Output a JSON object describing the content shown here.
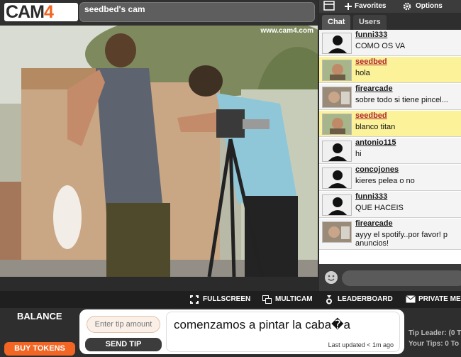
{
  "header": {
    "logo_main": "CAM",
    "logo_num": "4",
    "cam_title": "seedbed's cam"
  },
  "video": {
    "watermark": "www.cam4.com"
  },
  "chat_top": {
    "favorites": "Favorites",
    "options": "Options"
  },
  "tabs": {
    "chat": "Chat",
    "users": "Users"
  },
  "messages": [
    {
      "name": "funni333",
      "text": "COMO OS VA",
      "own": false
    },
    {
      "name": "seedbed",
      "text": "hola",
      "own": true
    },
    {
      "name": "firearcade",
      "text": "sobre todo si tiene pincel...",
      "own": false
    },
    {
      "name": "seedbed",
      "text": "blanco titan",
      "own": true
    },
    {
      "name": "antonio115",
      "text": "hi",
      "own": false
    },
    {
      "name": "concojones",
      "text": "kieres pelea o no",
      "own": false
    },
    {
      "name": "funni333",
      "text": "QUE HACEIS",
      "own": false
    },
    {
      "name": "firearcade",
      "text": "ayyy el spotify..por favor! p",
      "text2": "anuncios!",
      "own": false
    }
  ],
  "toolbar": {
    "fullscreen": "FULLSCREEN",
    "multicam": "MULTICAM",
    "leaderboard": "LEADERBOARD",
    "private": "PRIVATE ME"
  },
  "bottom": {
    "balance": "BALANCE",
    "buy_tokens": "BUY TOKENS",
    "tip_placeholder": "Enter tip amount",
    "send_tip": "SEND TIP",
    "topic": "comenzamos a pintar la caba�a",
    "last_updated": "Last updated < 1m ago",
    "tip_leader": "Tip Leader: (0 T",
    "your_tips": "Your Tips: 0 To"
  },
  "colors": {
    "brand_orange": "#f26522",
    "own_message_bg": "#fbf29a",
    "own_name": "#b0272b"
  }
}
